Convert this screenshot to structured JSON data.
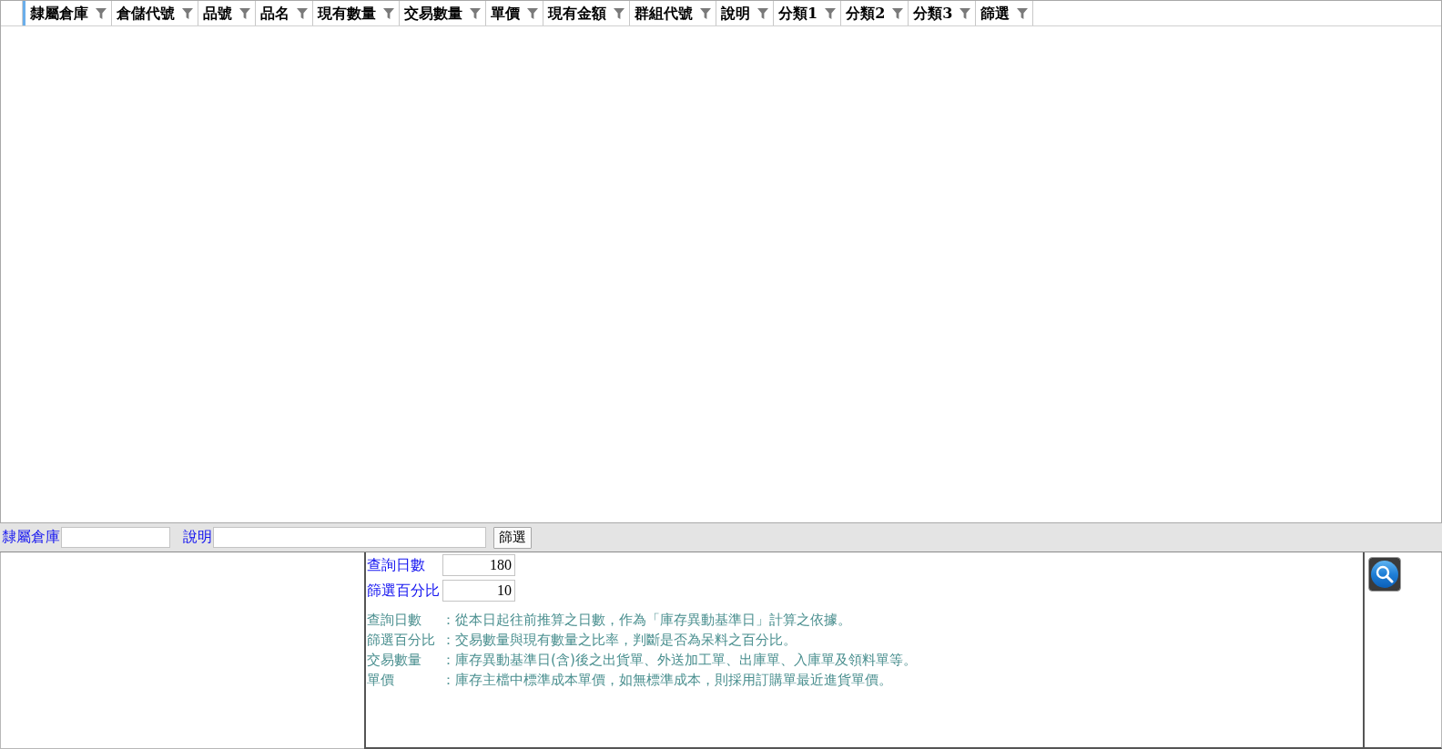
{
  "grid": {
    "columns": [
      "隸屬倉庫",
      "倉儲代號",
      "品號",
      "品名",
      "現有數量",
      "交易數量",
      "單價",
      "現有金額",
      "群組代號",
      "說明",
      "分類1",
      "分類2",
      "分類3",
      "篩選"
    ]
  },
  "filter_bar": {
    "fields": [
      {
        "label": "隸屬倉庫"
      },
      {
        "label": "說明"
      }
    ],
    "button": "篩選"
  },
  "query_panel": {
    "fields": [
      {
        "label": "查詢日數",
        "value": "180"
      },
      {
        "label": "篩選百分比",
        "value": "10"
      }
    ],
    "notes": [
      {
        "term": "查詢日數",
        "text": "：從本日起往前推算之日數，作為「庫存異動基準日」計算之依據。"
      },
      {
        "term": "篩選百分比",
        "text": "：交易數量與現有數量之比率，判斷是否為呆料之百分比。"
      },
      {
        "term": "交易數量",
        "text": "：庫存異動基準日(含)後之出貨單、外送加工單、出庫單、入庫單及領料單等。"
      },
      {
        "term": "單價",
        "text": "：庫存主檔中標準成本單價，如無標準成本，則採用訂購單最近進貨單價。"
      }
    ]
  }
}
